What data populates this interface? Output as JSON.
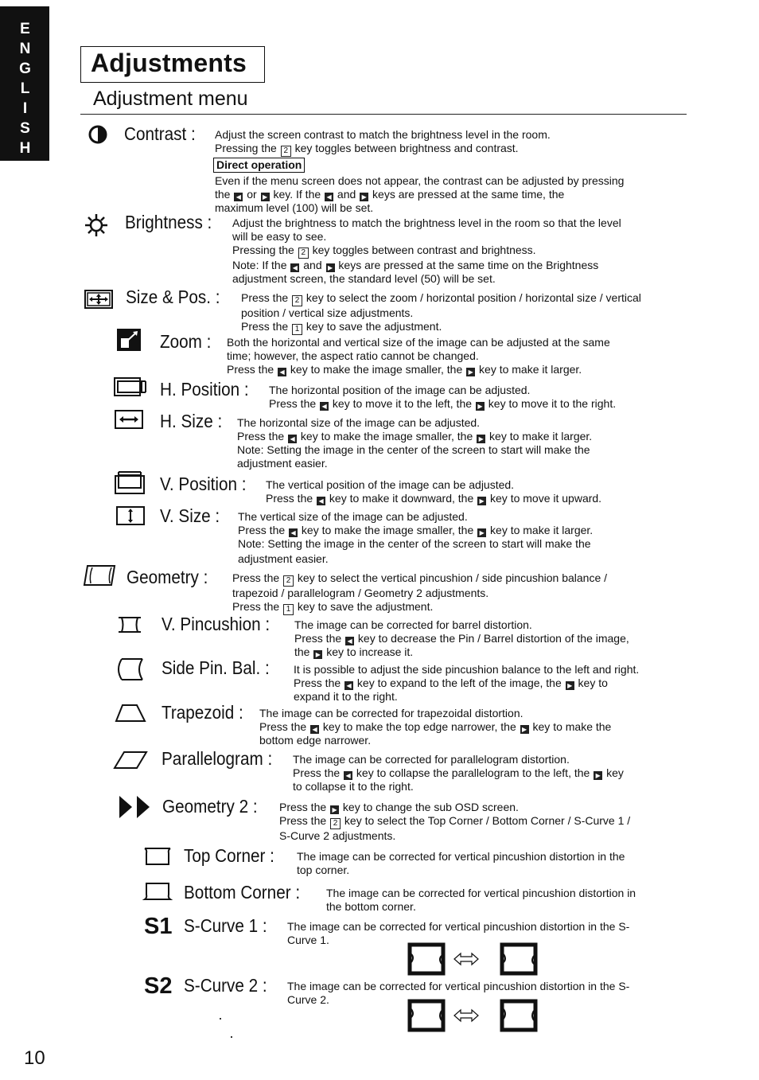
{
  "language_tab": "ENGLISH",
  "page_title": "Adjustments",
  "section_title": "Adjustment menu",
  "page_number": "10",
  "keys": {
    "left": "◀",
    "right": "▶",
    "one": "1",
    "two": "2"
  },
  "entries": {
    "contrast": {
      "icon": "contrast-half-circle-icon",
      "label": "Contrast :",
      "lines": [
        "Adjust the screen contrast to match the brightness level in the room."
      ],
      "toggle_pre": "Pressing the ",
      "toggle_post": " key toggles between brightness and contrast.",
      "direct_operation_label": "Direct operation",
      "direct_1": "Even if the menu screen does not appear, the contrast can be adjusted by pressing",
      "direct_2a": "the ",
      "direct_2b": " or ",
      "direct_2c": " key. If the ",
      "direct_2d": " and ",
      "direct_2e": " keys are pressed at the same time, the",
      "direct_3": "maximum level (100) will be set."
    },
    "brightness": {
      "icon": "brightness-sun-icon",
      "label": "Brightness :",
      "line1": "Adjust the brightness to match the brightness level in the room so that the level",
      "line2": "will be easy to see.",
      "toggle_pre": "Pressing the ",
      "toggle_post": " key toggles between contrast and brightness.",
      "note_a": "Note: If the ",
      "note_b": " and ",
      "note_c": " keys are pressed at the same time on the Brightness",
      "note_2": "adjustment screen, the standard level (50) will be set."
    },
    "size_pos": {
      "icon": "size-position-icon",
      "label": "Size & Pos. :",
      "line1a": "Press the ",
      "line1b": " key to select the zoom / horizontal position / horizontal size / vertical",
      "line2": "position / vertical size adjustments.",
      "line3a": "Press the ",
      "line3b": " key to save the adjustment."
    },
    "zoom": {
      "icon": "zoom-icon",
      "label": "Zoom :",
      "line1": "Both the horizontal and vertical size of the image can be adjusted at the same",
      "line2": "time; however, the aspect ratio cannot be changed.",
      "line3a": "Press the ",
      "line3b": " key to make the image smaller, the ",
      "line3c": " key to make it larger."
    },
    "h_position": {
      "icon": "horizontal-position-icon",
      "label": "H. Position :",
      "line1": "The horizontal position of the image can be adjusted.",
      "line2a": "Press the ",
      "line2b": " key to move it to the left, the ",
      "line2c": " key to move it to the right."
    },
    "h_size": {
      "icon": "horizontal-size-icon",
      "label": "H. Size :",
      "line1": "The horizontal size of the image can be adjusted.",
      "line2a": "Press the ",
      "line2b": " key to make the image smaller, the ",
      "line2c": " key to make it larger.",
      "note1": "Note: Setting the image in the center of the screen to start will make the",
      "note2": "adjustment easier."
    },
    "v_position": {
      "icon": "vertical-position-icon",
      "label": "V. Position :",
      "line1": "The vertical position of the image can be adjusted.",
      "line2a": "Press the ",
      "line2b": " key to make it downward, the ",
      "line2c": " key to move it upward."
    },
    "v_size": {
      "icon": "vertical-size-icon",
      "label": "V. Size :",
      "line1": "The vertical size of the image can be adjusted.",
      "line2a": "Press the ",
      "line2b": " key to make the image smaller, the ",
      "line2c": " key to make it larger.",
      "note1": "Note: Setting the image in the center of the screen to start will make the",
      "note2": "adjustment easier."
    },
    "geometry": {
      "icon": "geometry-icon",
      "label": "Geometry :",
      "line1a": "Press the ",
      "line1b": " key to select the vertical pincushion / side pincushion balance /",
      "line2": "trapezoid / parallelogram / Geometry 2 adjustments.",
      "line3a": "Press the ",
      "line3b": " key to save the adjustment."
    },
    "v_pincushion": {
      "icon": "vertical-pincushion-icon",
      "label": "V. Pincushion :",
      "line1": "The image can be corrected for barrel distortion.",
      "line2a": "Press the ",
      "line2b": " key to decrease the Pin / Barrel distortion of the image,",
      "line3a": "the ",
      "line3b": " key to increase it."
    },
    "side_pin_bal": {
      "icon": "side-pincushion-balance-icon",
      "label": "Side Pin. Bal. :",
      "line1": "It is possible to adjust the side pincushion balance to the left and right.",
      "line2a": "Press the ",
      "line2b": " key to expand to the left of the image, the ",
      "line2c": " key to",
      "line3": "expand it to the right."
    },
    "trapezoid": {
      "icon": "trapezoid-icon",
      "label": "Trapezoid :",
      "line1": "The image can be corrected for trapezoidal distortion.",
      "line2a": "Press the ",
      "line2b": " key to make the top edge narrower, the ",
      "line2c": " key to make the",
      "line3": "bottom edge narrower."
    },
    "parallelogram": {
      "icon": "parallelogram-icon",
      "label": "Parallelogram :",
      "line1": "The image can be corrected for parallelogram distortion.",
      "line2a": "Press the ",
      "line2b": " key to collapse the parallelogram to the left, the ",
      "line2c": " key",
      "line3": "to collapse it to the right."
    },
    "geometry2": {
      "icon": "double-play-icon",
      "label": "Geometry 2 :",
      "line1a": "Press the ",
      "line1b": " key to change the sub OSD screen.",
      "line2a": "Press the ",
      "line2b": " key to select the Top Corner / Bottom Corner / S-Curve 1 /",
      "line3": "S-Curve 2 adjustments."
    },
    "top_corner": {
      "icon": "top-corner-icon",
      "label": "Top Corner :",
      "line1": "The image can be corrected for vertical pincushion distortion in the",
      "line2": "top corner."
    },
    "bottom_corner": {
      "icon": "bottom-corner-icon",
      "label": "Bottom Corner :",
      "line1": "The image can be corrected for vertical pincushion distortion in",
      "line2": "the bottom corner."
    },
    "s_curve1": {
      "icon_text": "S1",
      "label": "S-Curve 1 :",
      "line1": "The image can be corrected for vertical pincushion distortion in the S-",
      "line2": "Curve 1."
    },
    "s_curve2": {
      "icon_text": "S2",
      "label": "S-Curve 2 :",
      "line1": "The image can be corrected for vertical pincushion distortion in the S-",
      "line2": "Curve 2."
    }
  }
}
